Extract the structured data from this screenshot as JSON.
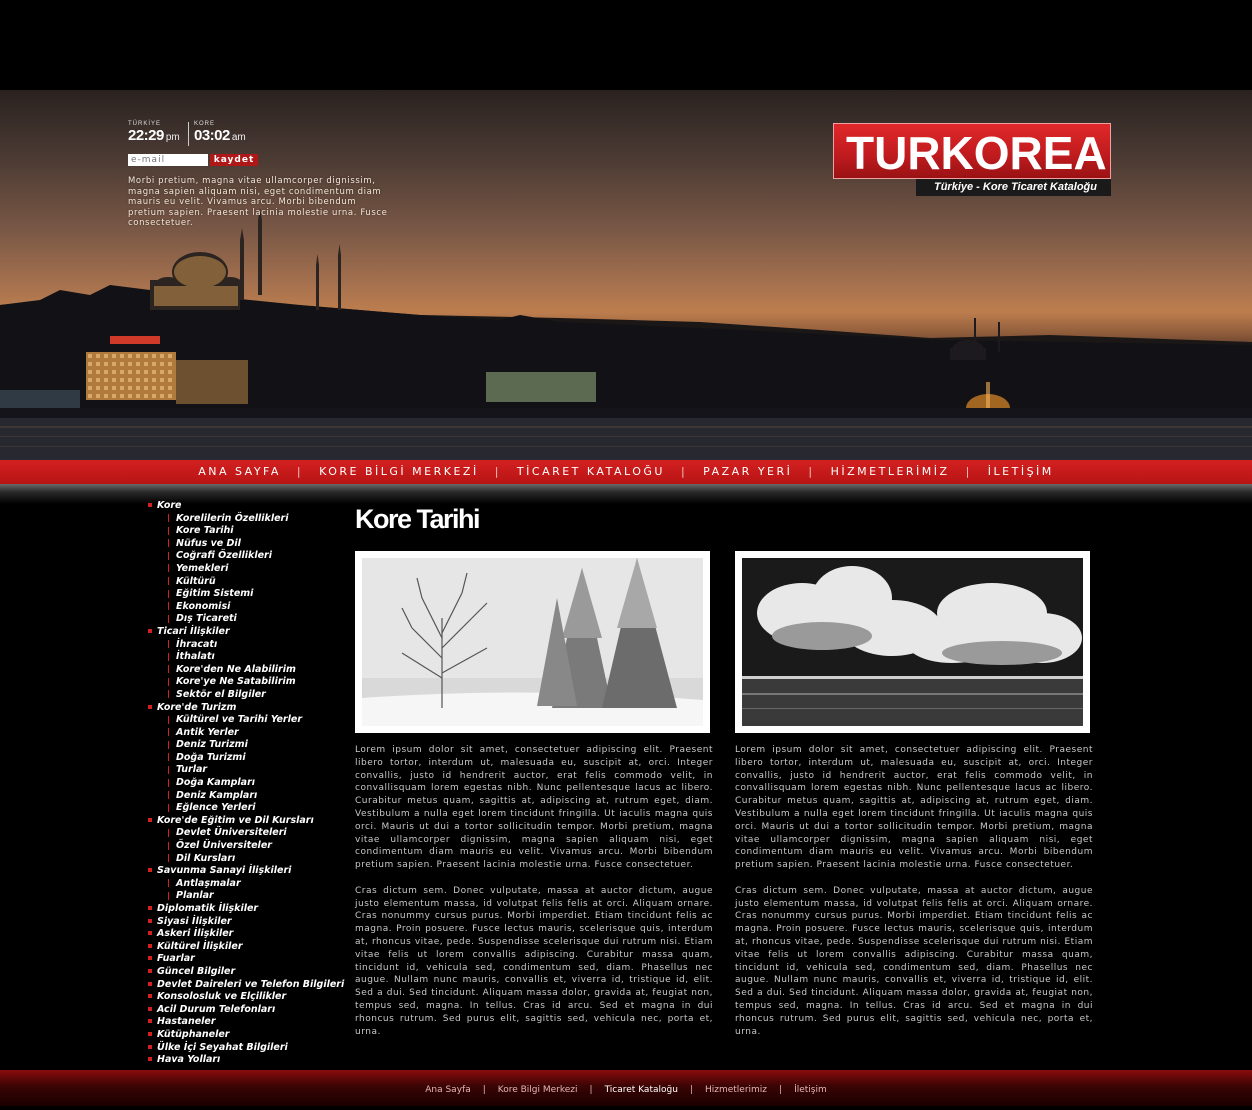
{
  "clocks": [
    {
      "city": "TÜRKİYE",
      "time": "22:29",
      "ampm": "pm"
    },
    {
      "city": "KORE",
      "time": "03:02",
      "ampm": "am"
    }
  ],
  "newsletter": {
    "placeholder": "e-mail",
    "button": "kaydet"
  },
  "intro_text": "Morbi pretium, magna vitae ullamcorper dignissim, magna sapien aliquam nisi, eget condimentum diam mauris eu velit. Vivamus arcu. Morbi bibendum pretium sapien. Praesent lacinia molestie urna. Fusce consectetuer.",
  "logo": {
    "text": "TURKOREA",
    "tagline": "Türkiye - Kore Ticaret Kataloğu"
  },
  "nav": [
    "ANA SAYFA",
    "KORE BİLGİ MERKEZİ",
    "TİCARET KATALOĞU",
    "PAZAR YERİ",
    "HİZMETLERİMİZ",
    "İLETİŞİM"
  ],
  "sidebar": [
    {
      "label": "Kore",
      "level": 1
    },
    {
      "label": "Korelilerin Özellikleri",
      "level": 2
    },
    {
      "label": "Kore Tarihi",
      "level": 2
    },
    {
      "label": "Nüfus ve Dil",
      "level": 2
    },
    {
      "label": "Coğrafi Özellikleri",
      "level": 2
    },
    {
      "label": "Yemekleri",
      "level": 2
    },
    {
      "label": "Kültürü",
      "level": 2
    },
    {
      "label": "Eğitim Sistemi",
      "level": 2
    },
    {
      "label": "Ekonomisi",
      "level": 2
    },
    {
      "label": "Dış Ticareti",
      "level": 2
    },
    {
      "label": "Ticari İlişkiler",
      "level": 1
    },
    {
      "label": "İhracatı",
      "level": 2
    },
    {
      "label": "İthalatı",
      "level": 2
    },
    {
      "label": "Kore'den Ne Alabilirim",
      "level": 2
    },
    {
      "label": "Kore'ye Ne Satabilirim",
      "level": 2
    },
    {
      "label": "Sektör el Bilgiler",
      "level": 2
    },
    {
      "label": "Kore'de Turizm",
      "level": 1
    },
    {
      "label": "Kültürel ve Tarihi Yerler",
      "level": 2
    },
    {
      "label": "Antik Yerler",
      "level": 2
    },
    {
      "label": "Deniz Turizmi",
      "level": 2
    },
    {
      "label": "Doğa Turizmi",
      "level": 2
    },
    {
      "label": "Turlar",
      "level": 2
    },
    {
      "label": "Doğa Kampları",
      "level": 2
    },
    {
      "label": "Deniz Kampları",
      "level": 2
    },
    {
      "label": "Eğlence Yerleri",
      "level": 2
    },
    {
      "label": "Kore'de Eğitim ve Dil Kursları",
      "level": 1
    },
    {
      "label": "Devlet Üniversiteleri",
      "level": 2
    },
    {
      "label": "Özel Üniversiteler",
      "level": 2
    },
    {
      "label": "Dil Kursları",
      "level": 2
    },
    {
      "label": "Savunma Sanayi İlişkileri",
      "level": 1
    },
    {
      "label": "Antlaşmalar",
      "level": 2
    },
    {
      "label": "Planlar",
      "level": 2
    },
    {
      "label": "Diplomatik İlişkiler",
      "level": 1
    },
    {
      "label": "Siyasi İlişkiler",
      "level": 1
    },
    {
      "label": "Askeri İlişkiler",
      "level": 1
    },
    {
      "label": "Kültürel İlişkiler",
      "level": 1
    },
    {
      "label": "Fuarlar",
      "level": 1
    },
    {
      "label": "Güncel Bilgiler",
      "level": 1
    },
    {
      "label": "Devlet Daireleri ve Telefon Bilgileri",
      "level": 1
    },
    {
      "label": "Konsolosluk ve Elçilikler",
      "level": 1
    },
    {
      "label": "Acil Durum Telefonları",
      "level": 1
    },
    {
      "label": "Hastaneler",
      "level": 1
    },
    {
      "label": "Kütüphaneler",
      "level": 1
    },
    {
      "label": "Ülke İçi Seyahat Bilgileri",
      "level": 1
    },
    {
      "label": "Hava Yolları",
      "level": 1
    }
  ],
  "main": {
    "title": "Kore Tarihi",
    "para1": "Lorem ipsum dolor sit amet, consectetuer adipiscing elit. Praesent libero tortor, interdum ut, malesuada eu, suscipit at, orci. Integer convallis, justo id hendrerit auctor, erat felis commodo velit, in convallisquam lorem egestas nibh. Nunc pellentesque lacus ac libero. Curabitur metus quam, sagittis at, adipiscing at, rutrum eget, diam. Vestibulum a nulla eget lorem tincidunt fringilla. Ut iaculis magna quis orci. Mauris ut dui a tortor sollicitudin tempor. Morbi pretium, magna vitae ullamcorper dignissim, magna sapien aliquam nisi, eget condimentum diam mauris eu velit. Vivamus arcu. Morbi bibendum pretium sapien. Praesent lacinia molestie urna. Fusce consectetuer.",
    "para2": "Cras dictum sem. Donec vulputate, massa at auctor dictum, augue justo elementum massa, id volutpat felis felis at orci. Aliquam ornare. Cras nonummy cursus purus. Morbi imperdiet. Etiam tincidunt felis ac magna. Proin posuere. Fusce lectus mauris, scelerisque quis, interdum at, rhoncus vitae, pede. Suspendisse scelerisque dui rutrum nisi. Etiam vitae felis ut lorem convallis adipiscing. Curabitur massa quam, tincidunt id, vehicula sed, condimentum sed, diam. Phasellus nec augue. Nullam nunc mauris, convallis et, viverra id, tristique id, elit. Sed a dui. Sed tincidunt. Aliquam massa dolor, gravida at, feugiat non, tempus sed, magna. In tellus. Cras id arcu. Sed et magna in dui rhoncus rutrum. Sed purus elit, sagittis sed, vehicula nec, porta et, urna."
  },
  "footer": [
    "Ana Sayfa",
    "Kore Bilgi Merkezi",
    "Ticaret Kataloğu",
    "Hizmetlerimiz",
    "İletişim"
  ],
  "footer_active": "Ticaret Kataloğu",
  "colors": {
    "accent": "#c81a1a",
    "background": "#000000",
    "text": "#c8c8c8"
  }
}
